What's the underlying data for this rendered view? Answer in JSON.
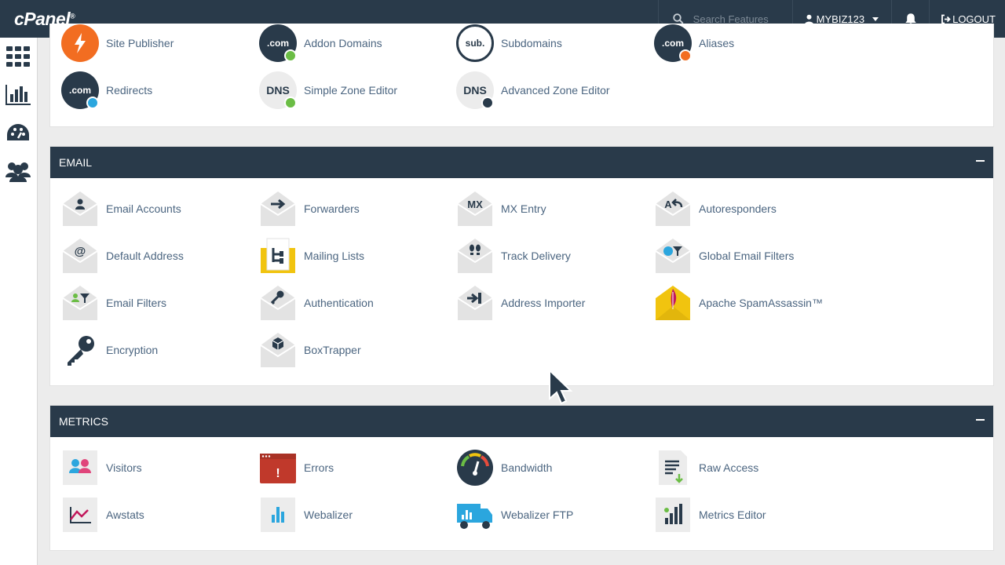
{
  "header": {
    "logo": "cPanel",
    "search_placeholder": "Search Features",
    "username": "MYBIZ123",
    "logout_label": "LOGOUT"
  },
  "sidebar": {
    "icons": [
      "grid-icon",
      "stats-icon",
      "dashboard-icon",
      "users-icon"
    ]
  },
  "domains_partial": {
    "items": [
      {
        "label": "Site Publisher",
        "icon": "site-publisher-icon"
      },
      {
        "label": "Addon Domains",
        "icon": "addon-domains-icon"
      },
      {
        "label": "Subdomains",
        "icon": "subdomains-icon"
      },
      {
        "label": "Aliases",
        "icon": "aliases-icon"
      },
      {
        "label": "Redirects",
        "icon": "redirects-icon"
      },
      {
        "label": "Simple Zone Editor",
        "icon": "simple-zone-editor-icon"
      },
      {
        "label": "Advanced Zone Editor",
        "icon": "advanced-zone-editor-icon"
      }
    ]
  },
  "email": {
    "title": "EMAIL",
    "items": [
      {
        "label": "Email Accounts",
        "icon": "email-accounts-icon"
      },
      {
        "label": "Forwarders",
        "icon": "forwarders-icon"
      },
      {
        "label": "MX Entry",
        "icon": "mx-entry-icon"
      },
      {
        "label": "Autoresponders",
        "icon": "autoresponders-icon"
      },
      {
        "label": "Default Address",
        "icon": "default-address-icon"
      },
      {
        "label": "Mailing Lists",
        "icon": "mailing-lists-icon"
      },
      {
        "label": "Track Delivery",
        "icon": "track-delivery-icon"
      },
      {
        "label": "Global Email Filters",
        "icon": "global-email-filters-icon"
      },
      {
        "label": "Email Filters",
        "icon": "email-filters-icon"
      },
      {
        "label": "Authentication",
        "icon": "authentication-icon"
      },
      {
        "label": "Address Importer",
        "icon": "address-importer-icon"
      },
      {
        "label": "Apache SpamAssassin™",
        "icon": "spamassassin-icon"
      },
      {
        "label": "Encryption",
        "icon": "encryption-key-icon"
      },
      {
        "label": "BoxTrapper",
        "icon": "boxtrapper-icon"
      }
    ]
  },
  "metrics": {
    "title": "METRICS",
    "items": [
      {
        "label": "Visitors",
        "icon": "visitors-icon"
      },
      {
        "label": "Errors",
        "icon": "errors-icon"
      },
      {
        "label": "Bandwidth",
        "icon": "bandwidth-icon"
      },
      {
        "label": "Raw Access",
        "icon": "raw-access-icon"
      },
      {
        "label": "Awstats",
        "icon": "awstats-icon"
      },
      {
        "label": "Webalizer",
        "icon": "webalizer-icon"
      },
      {
        "label": "Webalizer FTP",
        "icon": "webalizer-ftp-icon"
      },
      {
        "label": "Metrics Editor",
        "icon": "metrics-editor-icon"
      }
    ]
  },
  "colors": {
    "header_bg": "#293a4a",
    "link": "#4b6580",
    "accent_orange": "#f26d21",
    "badge_green": "#6bbd45",
    "badge_blue": "#2ba6de",
    "spam_yellow": "#f1c40f"
  }
}
